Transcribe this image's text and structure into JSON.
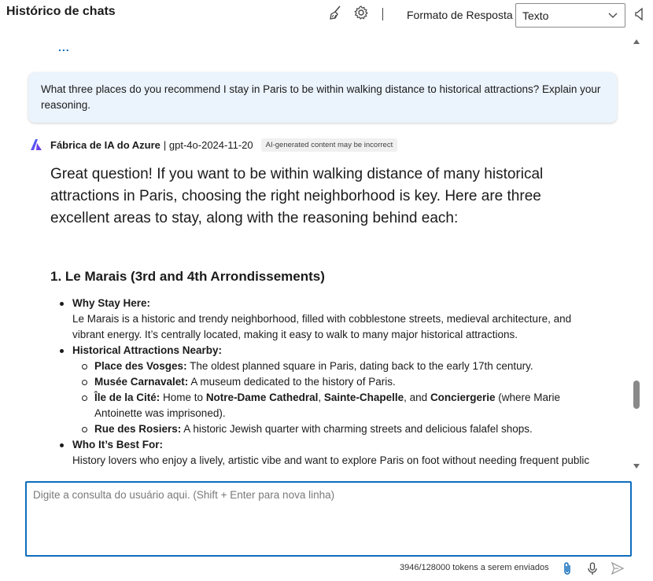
{
  "header": {
    "title": "Histórico de chats",
    "clear_icon": "broom-icon",
    "settings_icon": "gear-icon",
    "format_label": "Formato de Resposta",
    "format_value": "Texto",
    "side_icon": "speaker-icon"
  },
  "chat": {
    "ellipsis": "...",
    "user_message": " What three places do you recommend I stay in Paris to be within walking distance to historical attractions? Explain your reasoning.",
    "bot": {
      "name": "Fábrica de IA do Azure",
      "model": "| gpt-4o-2024-11-20",
      "badge": "AI-generated content may be incorrect",
      "intro": "Great question! If you want to be within walking distance of many historical attractions in Paris, choosing the right neighborhood is key. Here are three excellent areas to stay, along with the reasoning behind each:",
      "section_title": "1. Le Marais (3rd and 4th Arrondissements)",
      "why_label": "Why Stay Here:",
      "why_text": "Le Marais is a historic and trendy neighborhood, filled with cobblestone streets, medieval architecture, and vibrant energy. It’s centrally located, making it easy to walk to many major historical attractions.",
      "attractions_label": "Historical Attractions Nearby:",
      "attractions": [
        {
          "name": "Place des Vosges:",
          "text": " The oldest planned square in Paris, dating back to the early 17th century."
        },
        {
          "name": "Musée Carnavalet:",
          "text": " A museum dedicated to the history of Paris."
        },
        {
          "name": "Île de la Cité:",
          "text": " Home to "
        },
        {
          "name": "Rue des Rosiers:",
          "text": " A historic Jewish quarter with charming streets and delicious falafel shops."
        }
      ],
      "cite_parts": {
        "notre_dame": "Notre-Dame Cathedral",
        "comma1": ", ",
        "sainte": "Sainte-Chapelle",
        "and": ", and ",
        "conciergerie": "Conciergerie",
        "tail": " (where Marie Antoinette was imprisoned)."
      },
      "best_label": "Who It’s Best For:",
      "best_text": "History lovers who enjoy a lively, artistic vibe and want to explore Paris on foot without needing frequent public"
    }
  },
  "input": {
    "placeholder": "Digite a consulta do usuário aqui. (Shift + Enter para nova linha)"
  },
  "footer": {
    "tokens": "3946/128000 tokens a serem enviados",
    "attach_icon": "paperclip-icon",
    "mic_icon": "microphone-icon",
    "send_icon": "send-icon"
  }
}
